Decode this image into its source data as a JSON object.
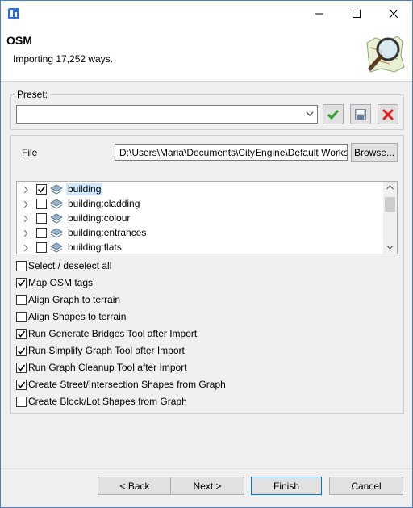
{
  "window": {
    "app_icon": "cityengine-app-icon",
    "minimize_icon": "minimize-icon",
    "maximize_icon": "maximize-icon",
    "close_icon": "close-icon"
  },
  "header": {
    "title": "OSM",
    "subtitle": "Importing 17,252 ways.",
    "logo_icon": "openstreetmap-magnifier-logo"
  },
  "preset": {
    "label": "Preset:",
    "value": "",
    "apply_icon": "green-check-icon",
    "save_icon": "save-disk-icon",
    "delete_icon": "red-x-icon"
  },
  "file": {
    "label": "File",
    "path": "D:\\Users\\Maria\\Documents\\CityEngine\\Default Workspace",
    "browse_label": "Browse..."
  },
  "layers": [
    {
      "label": "building",
      "checked": true,
      "selected": true
    },
    {
      "label": "building:cladding",
      "checked": false,
      "selected": false
    },
    {
      "label": "building:colour",
      "checked": false,
      "selected": false
    },
    {
      "label": "building:entrances",
      "checked": false,
      "selected": false
    },
    {
      "label": "building:flats",
      "checked": false,
      "selected": false
    }
  ],
  "options": [
    {
      "label": "Select / deselect all",
      "checked": false
    },
    {
      "label": "Map OSM tags",
      "checked": true
    },
    {
      "label": "Align Graph to terrain",
      "checked": false
    },
    {
      "label": "Align Shapes to terrain",
      "checked": false
    },
    {
      "label": "Run Generate Bridges Tool after Import",
      "checked": true
    },
    {
      "label": "Run Simplify Graph Tool after Import",
      "checked": true
    },
    {
      "label": "Run Graph Cleanup Tool after Import",
      "checked": true
    },
    {
      "label": "Create Street/Intersection Shapes from Graph",
      "checked": true
    },
    {
      "label": "Create Block/Lot Shapes from Graph",
      "checked": false
    }
  ],
  "footer": {
    "back_label": "< Back",
    "next_label": "Next >",
    "finish_label": "Finish",
    "cancel_label": "Cancel"
  }
}
